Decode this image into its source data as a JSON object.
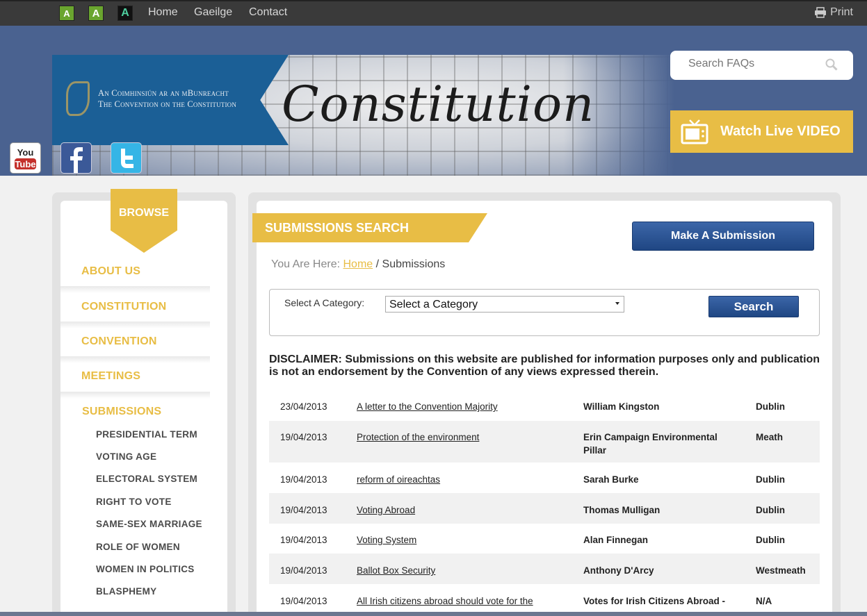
{
  "topbar": {
    "font_sizes": [
      "A",
      "A",
      "A"
    ],
    "nav": [
      "Home",
      "Gaeilge",
      "Contact"
    ],
    "print_label": "Print"
  },
  "header": {
    "org_line1": "An Coimhinsiún ar an mBunreacht",
    "org_line2": "The Convention on the Constitution",
    "script_text": "Constitution",
    "search_placeholder": "Search FAQs",
    "watch_label": "Watch Live VIDEO",
    "youtube_label": "You Tube"
  },
  "sidebar": {
    "browse_label": "BROWSE",
    "items": [
      "ABOUT US",
      "CONSTITUTION",
      "CONVENTION",
      "MEETINGS",
      "SUBMISSIONS"
    ],
    "subitems": [
      "PRESIDENTIAL TERM",
      "VOTING AGE",
      "ELECTORAL SYSTEM",
      "RIGHT TO VOTE",
      "SAME-SEX MARRIAGE",
      "ROLE OF WOMEN",
      "WOMEN IN POLITICS",
      "BLASPHEMY"
    ]
  },
  "main": {
    "title": "SUBMISSIONS SEARCH",
    "make_submission": "Make A Submission",
    "breadcrumb": {
      "prefix": "You Are Here:",
      "home": "Home",
      "sep": "/",
      "current": "Submissions"
    },
    "filter": {
      "label": "Select A Category:",
      "selected": "Select a Category",
      "search_label": "Search"
    },
    "disclaimer": "DISCLAIMER: Submissions on this website are published for information purposes only and publication is not an endorsement by the Convention of any views expressed therein.",
    "rows": [
      {
        "date": "23/04/2013",
        "title": "A letter to the Convention Majority",
        "name": "William Kingston",
        "place": "Dublin"
      },
      {
        "date": "19/04/2013",
        "title": "Protection of the environment",
        "name": "Erin Campaign Environmental Pillar",
        "place": "Meath"
      },
      {
        "date": "19/04/2013",
        "title": "reform of oireachtas",
        "name": "Sarah Burke",
        "place": "Dublin"
      },
      {
        "date": "19/04/2013",
        "title": "Voting Abroad",
        "name": "Thomas Mulligan",
        "place": "Dublin"
      },
      {
        "date": "19/04/2013",
        "title": "Voting System",
        "name": "Alan Finnegan",
        "place": "Dublin"
      },
      {
        "date": "19/04/2013",
        "title": "Ballot Box Security",
        "name": "Anthony D'Arcy",
        "place": "Westmeath"
      },
      {
        "date": "19/04/2013",
        "title": "All Irish citizens abroad should vote for the",
        "name": "Votes for Irish Citizens Abroad -",
        "place": "N/A"
      }
    ]
  }
}
